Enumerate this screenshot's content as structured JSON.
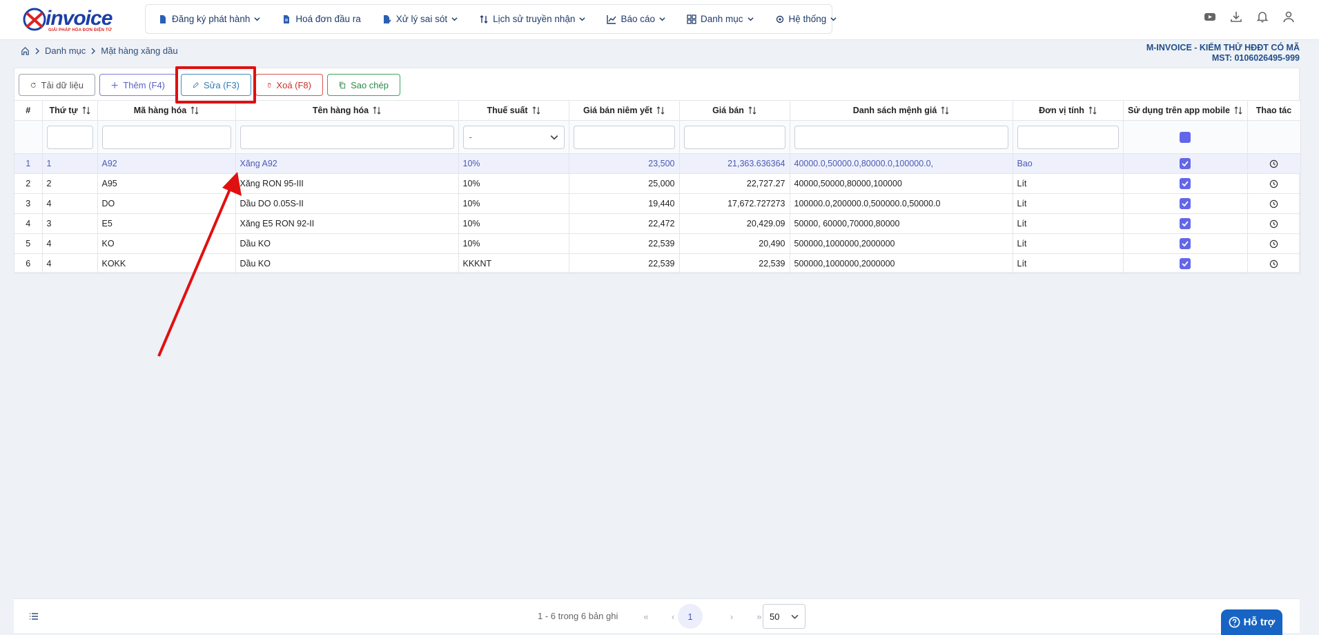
{
  "logo": {
    "text": "invoice",
    "tagline": "GIẢI PHÁP HÓA ĐƠN ĐIỆN TỬ"
  },
  "nav": [
    {
      "label": "Đăng ký phát hành",
      "icon": "file-icon",
      "dropdown": true
    },
    {
      "label": "Hoá đơn đầu ra",
      "icon": "document-icon",
      "dropdown": false
    },
    {
      "label": "Xử lý sai sót",
      "icon": "file-edit-icon",
      "dropdown": true
    },
    {
      "label": "Lịch sử truyền nhận",
      "icon": "sort-arrows-icon",
      "dropdown": true
    },
    {
      "label": "Báo cáo",
      "icon": "chart-icon",
      "dropdown": true
    },
    {
      "label": "Danh mục",
      "icon": "grid-icon",
      "dropdown": true
    },
    {
      "label": "Hệ thống",
      "icon": "gear-icon",
      "dropdown": true
    }
  ],
  "breadcrumb": [
    "Danh mục",
    "Mặt hàng xăng dầu"
  ],
  "company": {
    "name": "M-INVOICE - KIỂM THỬ HĐĐT CÓ MÃ",
    "tax": "MST: 0106026495-999"
  },
  "toolbar": {
    "reload": "Tải dữ liệu",
    "add": "Thêm (F4)",
    "edit": "Sửa (F3)",
    "delete": "Xoá (F8)",
    "copy": "Sao chép"
  },
  "table": {
    "columns": [
      "#",
      "Thứ tự",
      "Mã hàng hóa",
      "Tên hàng hóa",
      "Thuế suất",
      "Giá bán niêm yết",
      "Giá bán",
      "Danh sách mệnh giá",
      "Đơn vị tính",
      "Sử dụng trên app mobile",
      "Thao tác"
    ],
    "tax_filter": "-",
    "rows": [
      {
        "idx": "1",
        "order": "1",
        "code": "A92",
        "name": "Xăng A92",
        "tax": "10%",
        "list_price": "23,500",
        "price": "21,363.636364",
        "denoms": "40000.0,50000.0,80000.0,100000.0,",
        "unit": "Bao",
        "mobile": true
      },
      {
        "idx": "2",
        "order": "2",
        "code": "A95",
        "name": "Xăng RON 95-III",
        "tax": "10%",
        "list_price": "25,000",
        "price": "22,727.27",
        "denoms": "40000,50000,80000,100000",
        "unit": "Lít",
        "mobile": true
      },
      {
        "idx": "3",
        "order": "4",
        "code": "DO",
        "name": "Dầu DO 0.05S-II",
        "tax": "10%",
        "list_price": "19,440",
        "price": "17,672.727273",
        "denoms": "100000.0,200000.0,500000.0,50000.0",
        "unit": "Lít",
        "mobile": true
      },
      {
        "idx": "4",
        "order": "3",
        "code": "E5",
        "name": "Xăng E5 RON 92-II",
        "tax": "10%",
        "list_price": "22,472",
        "price": "20,429.09",
        "denoms": "50000, 60000,70000,80000",
        "unit": "Lít",
        "mobile": true
      },
      {
        "idx": "5",
        "order": "4",
        "code": "KO",
        "name": "Dầu KO",
        "tax": "10%",
        "list_price": "22,539",
        "price": "20,490",
        "denoms": "500000,1000000,2000000",
        "unit": "Lít",
        "mobile": true
      },
      {
        "idx": "6",
        "order": "4",
        "code": "KOKK",
        "name": "Dầu KO",
        "tax": "KKKNT",
        "list_price": "22,539",
        "price": "22,539",
        "denoms": "500000,1000000,2000000",
        "unit": "Lít",
        "mobile": true
      }
    ]
  },
  "pagination": {
    "info": "1 - 6 trong 6 bản ghi",
    "current": "1",
    "page_size": "50"
  },
  "support": {
    "label": "Hỗ trợ"
  },
  "colors": {
    "brand": "#1b3fa6",
    "accent": "#6366e8",
    "annotation": "#e01010"
  }
}
